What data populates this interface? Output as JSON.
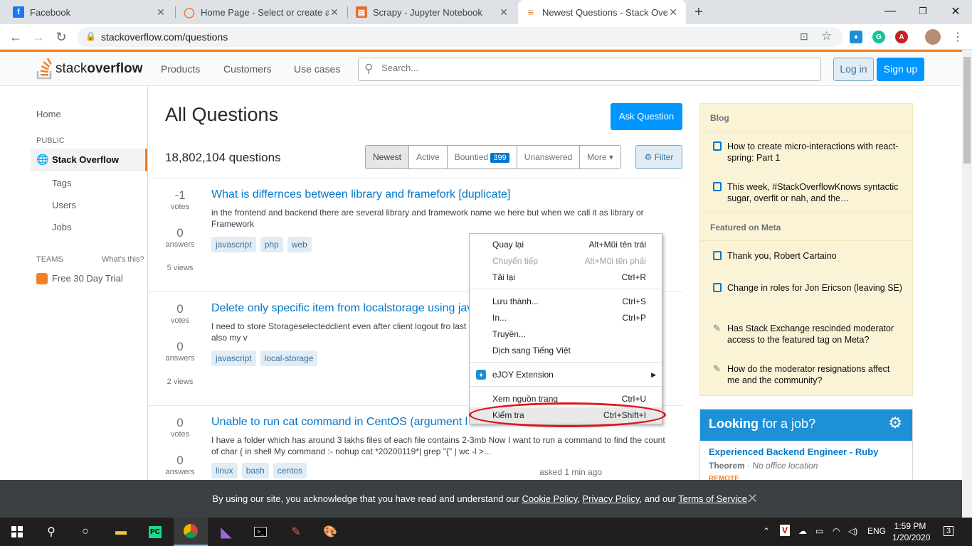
{
  "browser": {
    "tabs": [
      {
        "title": "Facebook",
        "icon": "facebook-icon",
        "color": "#1877f2"
      },
      {
        "title": "Home Page - Select or create a n",
        "icon": "jupyter-icon",
        "color": "#f37726"
      },
      {
        "title": "Scrapy - Jupyter Notebook",
        "icon": "notebook-icon",
        "color": "#e46e2e"
      },
      {
        "title": "Newest Questions - Stack Overflo",
        "icon": "stackoverflow-icon",
        "color": "#f48024"
      }
    ],
    "url": "stackoverflow.com/questions"
  },
  "so_header": {
    "logo_light": "stack",
    "logo_bold": "overflow",
    "nav": [
      "Products",
      "Customers",
      "Use cases"
    ],
    "search_placeholder": "Search...",
    "login": "Log in",
    "signup": "Sign up"
  },
  "sidebar": {
    "home": "Home",
    "public": "PUBLIC",
    "stack_overflow": "Stack Overflow",
    "tags": "Tags",
    "users": "Users",
    "jobs": "Jobs",
    "teams": "TEAMS",
    "whats_this": "What's this?",
    "trial": "Free 30 Day Trial"
  },
  "main": {
    "title": "All Questions",
    "ask_button": "Ask Question",
    "count": "18,802,104 questions",
    "filters": [
      "Newest",
      "Active",
      "Bountied",
      "Unanswered",
      "More ▾"
    ],
    "bountied_count": "399",
    "filter_button": "Filter",
    "questions": [
      {
        "votes": "-1",
        "votes_label": "votes",
        "answers": "0",
        "answers_label": "answers",
        "views": "5 views",
        "title": "What is differnces between library and framefork [duplicate]",
        "excerpt": "in the frontend and backend there are several library and framework name we here but when we call it as library or Framework",
        "tags": [
          "javascript",
          "php",
          "web"
        ]
      },
      {
        "votes": "0",
        "votes_label": "votes",
        "answers": "0",
        "answers_label": "answers",
        "views": "2 views",
        "title": "Delete only specific item from localstorage using jav",
        "excerpt": "I need to store Storageselectedclient even after client logout fro last selected clients will shown up but it's not working also my v",
        "tags": [
          "javascript",
          "local-storage"
        ]
      },
      {
        "votes": "0",
        "votes_label": "votes",
        "answers": "0",
        "answers_label": "answers",
        "views": "",
        "title": "Unable to run cat command in CentOS (argument l",
        "excerpt": "I have a folder which has around 3 lakhs files of each file contains 2-3mb Now I want to run a command to find the count of char { in shell My command :- nohup cat *20200119*| grep \"{\" | wc -l >...",
        "tags": [
          "linux",
          "bash",
          "centos"
        ],
        "asked": "asked 1 min ago"
      }
    ]
  },
  "right_sidebar": {
    "blog_header": "Blog",
    "blog_items": [
      "How to create micro-interactions with react-spring: Part 1",
      "This week, #StackOverflowKnows syntactic sugar, overfit or nah, and the…"
    ],
    "meta_header": "Featured on Meta",
    "meta_items": [
      "Thank you, Robert Cartaino",
      "Change in roles for Jon Ericson (leaving SE)",
      "Has Stack Exchange rescinded moderator access to the featured tag on Meta?",
      "How do the moderator resignations affect me and the community?"
    ],
    "job_banner_bold": "Looking",
    "job_banner_rest": " for a job?",
    "job_title": "Experienced Backend Engineer - Ruby",
    "job_company": "Theorem",
    "job_location": "No office location",
    "job_remote": "REMOTE"
  },
  "cookie": {
    "prefix": "By using our site, you acknowledge that you have read and understand our ",
    "cookie_policy": "Cookie Policy",
    "sep1": ", ",
    "privacy_policy": "Privacy Policy",
    "sep2": ", and our ",
    "terms": "Terms of Service",
    "suffix": "."
  },
  "context_menu": {
    "items": [
      {
        "label": "Quay lại",
        "shortcut": "Alt+Mũi tên trái"
      },
      {
        "label": "Chuyển tiếp",
        "shortcut": "Alt+Mũi tên phải"
      },
      {
        "label": "Tải lại",
        "shortcut": "Ctrl+R"
      },
      {
        "label": "Lưu thành...",
        "shortcut": "Ctrl+S"
      },
      {
        "label": "In...",
        "shortcut": "Ctrl+P"
      },
      {
        "label": "Truyền...",
        "shortcut": ""
      },
      {
        "label": "Dịch sang Tiếng Việt",
        "shortcut": ""
      },
      {
        "label": "eJOY Extension",
        "shortcut": "▶"
      },
      {
        "label": "Xem nguồn trang",
        "shortcut": "Ctrl+U"
      },
      {
        "label": "Kiểm tra",
        "shortcut": "Ctrl+Shift+I"
      }
    ]
  },
  "taskbar": {
    "lang": "ENG",
    "time": "1:59 PM",
    "date": "1/20/2020",
    "notifications": "3"
  }
}
